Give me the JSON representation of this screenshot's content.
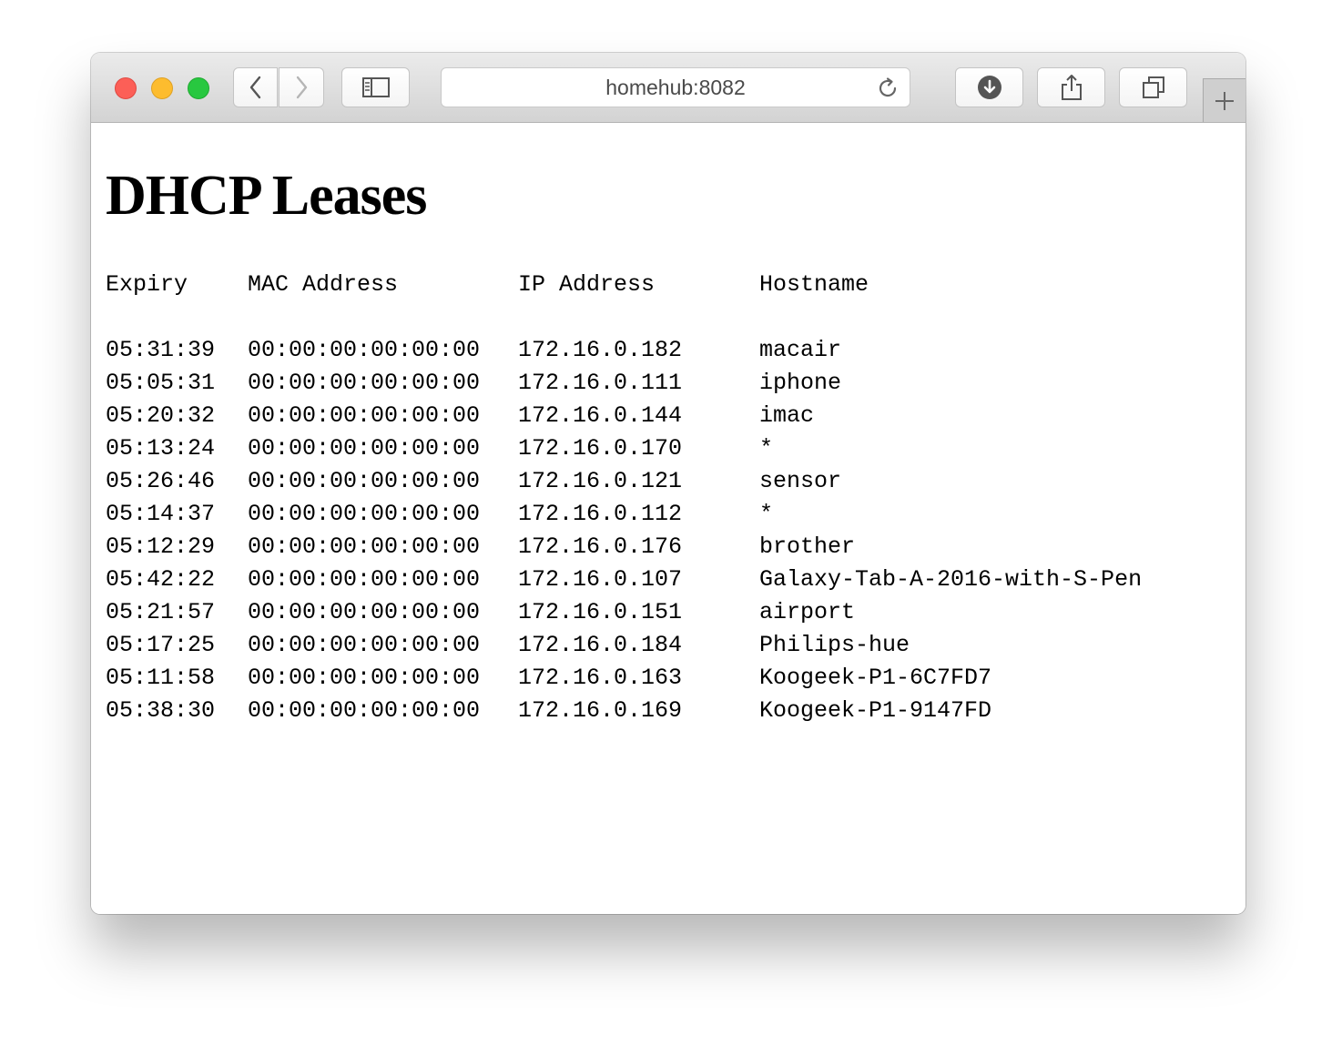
{
  "browser": {
    "url": "homehub:8082"
  },
  "page": {
    "title": "DHCP Leases",
    "columns": {
      "expiry": "Expiry",
      "mac": "MAC Address",
      "ip": "IP Address",
      "hostname": "Hostname"
    },
    "leases": [
      {
        "expiry": "05:31:39",
        "mac": "00:00:00:00:00:00",
        "ip": "172.16.0.182",
        "hostname": "macair"
      },
      {
        "expiry": "05:05:31",
        "mac": "00:00:00:00:00:00",
        "ip": "172.16.0.111",
        "hostname": "iphone"
      },
      {
        "expiry": "05:20:32",
        "mac": "00:00:00:00:00:00",
        "ip": "172.16.0.144",
        "hostname": "imac"
      },
      {
        "expiry": "05:13:24",
        "mac": "00:00:00:00:00:00",
        "ip": "172.16.0.170",
        "hostname": "*"
      },
      {
        "expiry": "05:26:46",
        "mac": "00:00:00:00:00:00",
        "ip": "172.16.0.121",
        "hostname": "sensor"
      },
      {
        "expiry": "05:14:37",
        "mac": "00:00:00:00:00:00",
        "ip": "172.16.0.112",
        "hostname": "*"
      },
      {
        "expiry": "05:12:29",
        "mac": "00:00:00:00:00:00",
        "ip": "172.16.0.176",
        "hostname": "brother"
      },
      {
        "expiry": "05:42:22",
        "mac": "00:00:00:00:00:00",
        "ip": "172.16.0.107",
        "hostname": "Galaxy-Tab-A-2016-with-S-Pen"
      },
      {
        "expiry": "05:21:57",
        "mac": "00:00:00:00:00:00",
        "ip": "172.16.0.151",
        "hostname": "airport"
      },
      {
        "expiry": "05:17:25",
        "mac": "00:00:00:00:00:00",
        "ip": "172.16.0.184",
        "hostname": "Philips-hue"
      },
      {
        "expiry": "05:11:58",
        "mac": "00:00:00:00:00:00",
        "ip": "172.16.0.163",
        "hostname": "Koogeek-P1-6C7FD7"
      },
      {
        "expiry": "05:38:30",
        "mac": "00:00:00:00:00:00",
        "ip": "172.16.0.169",
        "hostname": "Koogeek-P1-9147FD"
      }
    ]
  }
}
